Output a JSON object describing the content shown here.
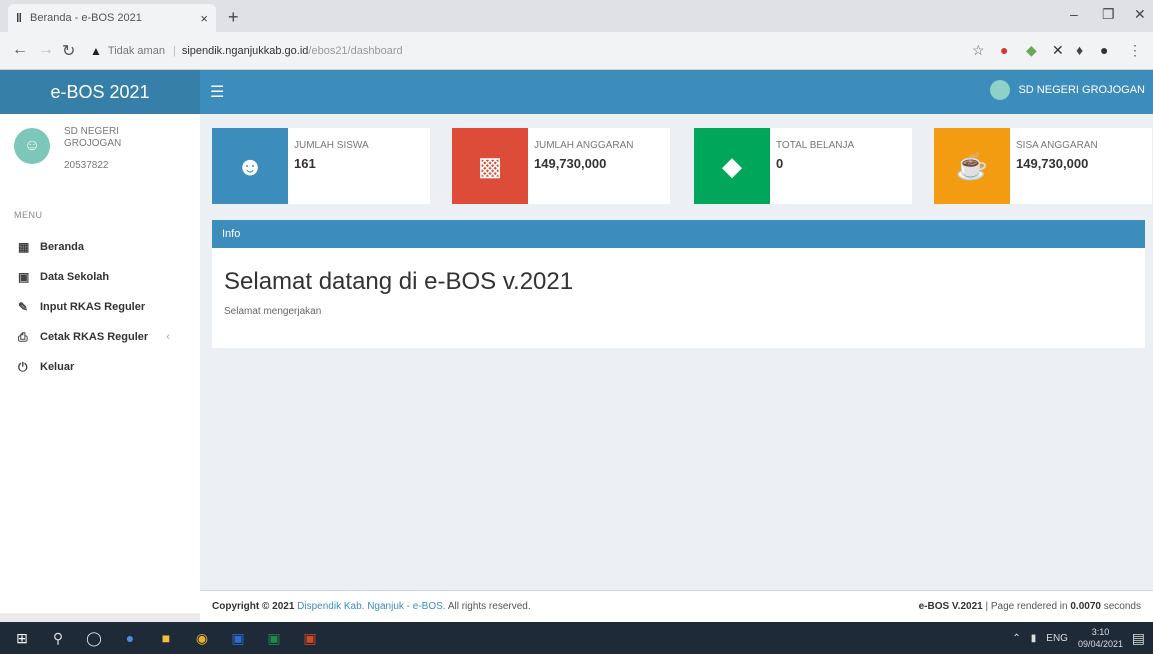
{
  "browser": {
    "tab_title": "Beranda - e-BOS 2021",
    "tab_close": "×",
    "new_tab": "+",
    "insecure_label": "Tidak aman",
    "url_host": "sipendik.nganjukkab.go.id",
    "url_path": "/ebos21/dashboard"
  },
  "header": {
    "logo": "e-BOS 2021",
    "user_name": "SD NEGERI GROJOGAN"
  },
  "sidebar": {
    "school_name": "SD NEGERI GROJOGAN",
    "school_code": "20537822",
    "menu_header": "MENU",
    "items": [
      {
        "label": "Beranda",
        "icon": "dashboard-icon"
      },
      {
        "label": "Data Sekolah",
        "icon": "book-icon"
      },
      {
        "label": "Input RKAS Reguler",
        "icon": "edit-icon"
      },
      {
        "label": "Cetak RKAS Reguler",
        "icon": "print-icon"
      },
      {
        "label": "Keluar",
        "icon": "power-icon"
      }
    ],
    "caret": "‹"
  },
  "info_boxes": [
    {
      "label": "JUMLAH SISWA",
      "value": "161",
      "color": "#3c8dbc"
    },
    {
      "label": "JUMLAH ANGGARAN",
      "value": "149,730,000",
      "color": "#dd4b39"
    },
    {
      "label": "TOTAL BELANJA",
      "value": "0",
      "color": "#00a65a"
    },
    {
      "label": "SISA ANGGARAN",
      "value": "149,730,000",
      "color": "#f39c12"
    }
  ],
  "panel": {
    "title": "Info",
    "welcome": "Selamat datang di e-BOS v.2021",
    "subtext": "Selamat mengerjakan"
  },
  "footer": {
    "copyright_prefix": "Copyright © 2021",
    "link_text": "Dispendik Kab. Nganjuk - e-BOS.",
    "rights": "All rights reserved.",
    "version": "e-BOS V.2021",
    "rendered_prefix": "| Page rendered in",
    "render_time": "0.0070",
    "rendered_suffix": "seconds"
  },
  "taskbar": {
    "lang": "ENG",
    "time": "3:10",
    "date": "09/04/2021"
  }
}
